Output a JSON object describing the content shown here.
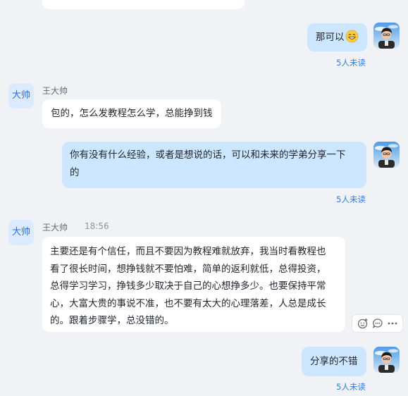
{
  "messages": {
    "m1": {
      "text": "那可以",
      "emoji": "grinning-emoji",
      "read_status": "5人未读"
    },
    "m2": {
      "sender_avatar": "大帅",
      "sender_name": "王大帅",
      "text": "包的，怎么发教程怎么学，总能挣到钱"
    },
    "m3": {
      "line1": "你有没有什么经验，或者是想说的话，可以和未来的学弟分享一下",
      "line2": "的",
      "read_status": "5人未读"
    },
    "m4": {
      "sender_avatar": "大帅",
      "sender_name": "王大帅",
      "time": "18:56",
      "lines": [
        "主要还是有个信任，而且不要因为教程难就放弃，我当时看教程也",
        "看了很长时间，想挣钱就不要怕难，简单的返利就低，总得投资，",
        "总得学习学习，挣钱多少取决于自己的心想挣多少。也要保持平常",
        "心，大富大贵的事说不准，也不要有太大的心理落差，人总是成长",
        "的。跟着步骤学，总没错的。"
      ]
    },
    "m5": {
      "text": "分享的不错",
      "read_status": "5人未读"
    }
  },
  "toolbar": {
    "icons": [
      "emoji-reaction-icon",
      "comment-icon",
      "more-icon"
    ]
  },
  "colors": {
    "accent": "#2f7de1",
    "bubble_mine": "#cde6ff",
    "bubble_other": "#ffffff",
    "background": "#f0f2f5"
  }
}
